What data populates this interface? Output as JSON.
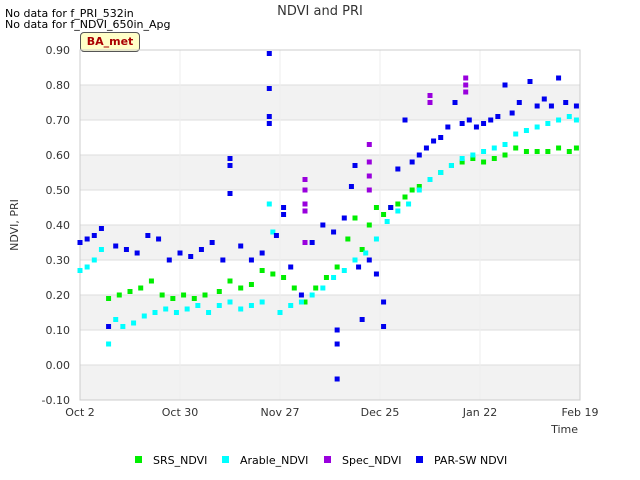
{
  "notes": [
    "No data for f_PRI_532in",
    "No data for f_NDVI_650in_Apg"
  ],
  "badge": "BA_met",
  "chart_data": {
    "type": "scatter",
    "title": "NDVI and PRI",
    "xlabel": "Time",
    "ylabel": "NDVI, PRI",
    "xlim": [
      "2022-10-02",
      "2023-02-19"
    ],
    "ylim": [
      -0.1,
      0.9
    ],
    "yticks": [
      -0.1,
      0.0,
      0.1,
      0.2,
      0.3,
      0.4,
      0.5,
      0.6,
      0.7,
      0.8,
      0.9
    ],
    "ytick_labels": [
      "-0.10",
      "0.00",
      "0.10",
      "0.20",
      "0.30",
      "0.40",
      "0.50",
      "0.60",
      "0.70",
      "0.80",
      "0.90"
    ],
    "xticks": [
      "2022-10-02",
      "2022-10-30",
      "2022-11-27",
      "2022-12-25",
      "2023-01-22",
      "2023-02-19"
    ],
    "xtick_labels": [
      "Oct 2",
      "Oct 30",
      "Nov 27",
      "Dec 25",
      "Jan 22",
      "Feb 19"
    ],
    "grid": "horizontal alternating bands",
    "legend_position": "bottom",
    "series": [
      {
        "name": "SRS_NDVI",
        "color": "#00ee00",
        "points": [
          [
            "2022-10-10",
            0.19
          ],
          [
            "2022-10-13",
            0.2
          ],
          [
            "2022-10-16",
            0.21
          ],
          [
            "2022-10-19",
            0.22
          ],
          [
            "2022-10-22",
            0.24
          ],
          [
            "2022-10-25",
            0.2
          ],
          [
            "2022-10-28",
            0.19
          ],
          [
            "2022-10-31",
            0.2
          ],
          [
            "2022-11-03",
            0.19
          ],
          [
            "2022-11-06",
            0.2
          ],
          [
            "2022-11-10",
            0.21
          ],
          [
            "2022-11-13",
            0.24
          ],
          [
            "2022-11-16",
            0.22
          ],
          [
            "2022-11-19",
            0.23
          ],
          [
            "2022-11-22",
            0.27
          ],
          [
            "2022-11-25",
            0.26
          ],
          [
            "2022-11-28",
            0.25
          ],
          [
            "2022-12-01",
            0.22
          ],
          [
            "2022-12-04",
            0.18
          ],
          [
            "2022-12-07",
            0.22
          ],
          [
            "2022-12-10",
            0.25
          ],
          [
            "2022-12-13",
            0.28
          ],
          [
            "2022-12-16",
            0.36
          ],
          [
            "2022-12-18",
            0.42
          ],
          [
            "2022-12-20",
            0.33
          ],
          [
            "2022-12-22",
            0.4
          ],
          [
            "2022-12-24",
            0.45
          ],
          [
            "2022-12-26",
            0.43
          ],
          [
            "2022-12-28",
            0.45
          ],
          [
            "2022-12-30",
            0.46
          ],
          [
            "2023-01-01",
            0.48
          ],
          [
            "2023-01-03",
            0.5
          ],
          [
            "2023-01-05",
            0.51
          ],
          [
            "2023-01-08",
            0.53
          ],
          [
            "2023-01-11",
            0.55
          ],
          [
            "2023-01-14",
            0.57
          ],
          [
            "2023-01-17",
            0.58
          ],
          [
            "2023-01-20",
            0.59
          ],
          [
            "2023-01-23",
            0.58
          ],
          [
            "2023-01-26",
            0.59
          ],
          [
            "2023-01-29",
            0.6
          ],
          [
            "2023-02-01",
            0.62
          ],
          [
            "2023-02-04",
            0.61
          ],
          [
            "2023-02-07",
            0.61
          ],
          [
            "2023-02-10",
            0.61
          ],
          [
            "2023-02-13",
            0.62
          ],
          [
            "2023-02-16",
            0.61
          ],
          [
            "2023-02-18",
            0.62
          ]
        ]
      },
      {
        "name": "Arable_NDVI",
        "color": "#00ffff",
        "points": [
          [
            "2022-10-02",
            0.27
          ],
          [
            "2022-10-04",
            0.28
          ],
          [
            "2022-10-06",
            0.3
          ],
          [
            "2022-10-08",
            0.33
          ],
          [
            "2022-10-10",
            0.06
          ],
          [
            "2022-10-12",
            0.13
          ],
          [
            "2022-10-14",
            0.11
          ],
          [
            "2022-10-17",
            0.12
          ],
          [
            "2022-10-20",
            0.14
          ],
          [
            "2022-10-23",
            0.15
          ],
          [
            "2022-10-26",
            0.16
          ],
          [
            "2022-10-29",
            0.15
          ],
          [
            "2022-11-01",
            0.16
          ],
          [
            "2022-11-04",
            0.17
          ],
          [
            "2022-11-07",
            0.15
          ],
          [
            "2022-11-10",
            0.17
          ],
          [
            "2022-11-13",
            0.18
          ],
          [
            "2022-11-16",
            0.16
          ],
          [
            "2022-11-19",
            0.17
          ],
          [
            "2022-11-22",
            0.18
          ],
          [
            "2022-11-24",
            0.46
          ],
          [
            "2022-11-25",
            0.38
          ],
          [
            "2022-11-27",
            0.15
          ],
          [
            "2022-11-30",
            0.17
          ],
          [
            "2022-12-03",
            0.18
          ],
          [
            "2022-12-06",
            0.2
          ],
          [
            "2022-12-09",
            0.22
          ],
          [
            "2022-12-12",
            0.25
          ],
          [
            "2022-12-15",
            0.27
          ],
          [
            "2022-12-18",
            0.3
          ],
          [
            "2022-12-21",
            0.32
          ],
          [
            "2022-12-24",
            0.36
          ],
          [
            "2022-12-27",
            0.41
          ],
          [
            "2022-12-30",
            0.44
          ],
          [
            "2023-01-02",
            0.46
          ],
          [
            "2023-01-05",
            0.5
          ],
          [
            "2023-01-08",
            0.53
          ],
          [
            "2023-01-11",
            0.55
          ],
          [
            "2023-01-14",
            0.57
          ],
          [
            "2023-01-17",
            0.59
          ],
          [
            "2023-01-20",
            0.6
          ],
          [
            "2023-01-23",
            0.61
          ],
          [
            "2023-01-26",
            0.62
          ],
          [
            "2023-01-29",
            0.63
          ],
          [
            "2023-02-01",
            0.66
          ],
          [
            "2023-02-04",
            0.67
          ],
          [
            "2023-02-07",
            0.68
          ],
          [
            "2023-02-10",
            0.69
          ],
          [
            "2023-02-13",
            0.7
          ],
          [
            "2023-02-16",
            0.71
          ],
          [
            "2023-02-18",
            0.7
          ]
        ]
      },
      {
        "name": "Spec_NDVI",
        "color": "#9900dd",
        "points": [
          [
            "2022-12-04",
            0.53
          ],
          [
            "2022-12-04",
            0.5
          ],
          [
            "2022-12-04",
            0.46
          ],
          [
            "2022-12-04",
            0.44
          ],
          [
            "2022-12-04",
            0.35
          ],
          [
            "2022-12-22",
            0.63
          ],
          [
            "2022-12-22",
            0.58
          ],
          [
            "2022-12-22",
            0.54
          ],
          [
            "2022-12-22",
            0.5
          ],
          [
            "2023-01-08",
            0.77
          ],
          [
            "2023-01-08",
            0.75
          ],
          [
            "2023-01-18",
            0.82
          ],
          [
            "2023-01-18",
            0.8
          ],
          [
            "2023-01-18",
            0.78
          ]
        ]
      },
      {
        "name": "PAR-SW NDVI",
        "color": "#0000ee",
        "points": [
          [
            "2022-10-02",
            0.35
          ],
          [
            "2022-10-04",
            0.36
          ],
          [
            "2022-10-06",
            0.37
          ],
          [
            "2022-10-08",
            0.39
          ],
          [
            "2022-10-10",
            0.11
          ],
          [
            "2022-10-12",
            0.34
          ],
          [
            "2022-10-15",
            0.33
          ],
          [
            "2022-10-18",
            0.32
          ],
          [
            "2022-10-21",
            0.37
          ],
          [
            "2022-10-24",
            0.36
          ],
          [
            "2022-10-27",
            0.3
          ],
          [
            "2022-10-30",
            0.32
          ],
          [
            "2022-11-02",
            0.31
          ],
          [
            "2022-11-05",
            0.33
          ],
          [
            "2022-11-08",
            0.35
          ],
          [
            "2022-11-11",
            0.3
          ],
          [
            "2022-11-13",
            0.59
          ],
          [
            "2022-11-13",
            0.57
          ],
          [
            "2022-11-13",
            0.49
          ],
          [
            "2022-11-16",
            0.34
          ],
          [
            "2022-11-19",
            0.3
          ],
          [
            "2022-11-22",
            0.32
          ],
          [
            "2022-11-24",
            0.89
          ],
          [
            "2022-11-24",
            0.79
          ],
          [
            "2022-11-24",
            0.71
          ],
          [
            "2022-11-24",
            0.69
          ],
          [
            "2022-11-26",
            0.37
          ],
          [
            "2022-11-28",
            0.45
          ],
          [
            "2022-11-28",
            0.43
          ],
          [
            "2022-11-30",
            0.28
          ],
          [
            "2022-12-03",
            0.2
          ],
          [
            "2022-12-06",
            0.35
          ],
          [
            "2022-12-09",
            0.4
          ],
          [
            "2022-12-12",
            0.38
          ],
          [
            "2022-12-13",
            0.1
          ],
          [
            "2022-12-13",
            0.06
          ],
          [
            "2022-12-13",
            -0.04
          ],
          [
            "2022-12-15",
            0.42
          ],
          [
            "2022-12-17",
            0.51
          ],
          [
            "2022-12-18",
            0.57
          ],
          [
            "2022-12-19",
            0.28
          ],
          [
            "2022-12-20",
            0.13
          ],
          [
            "2022-12-22",
            0.3
          ],
          [
            "2022-12-24",
            0.26
          ],
          [
            "2022-12-26",
            0.18
          ],
          [
            "2022-12-26",
            0.11
          ],
          [
            "2022-12-28",
            0.45
          ],
          [
            "2022-12-30",
            0.56
          ],
          [
            "2023-01-01",
            0.7
          ],
          [
            "2023-01-03",
            0.58
          ],
          [
            "2023-01-05",
            0.6
          ],
          [
            "2023-01-07",
            0.62
          ],
          [
            "2023-01-09",
            0.64
          ],
          [
            "2023-01-11",
            0.65
          ],
          [
            "2023-01-13",
            0.68
          ],
          [
            "2023-01-15",
            0.75
          ],
          [
            "2023-01-17",
            0.69
          ],
          [
            "2023-01-19",
            0.7
          ],
          [
            "2023-01-21",
            0.68
          ],
          [
            "2023-01-23",
            0.69
          ],
          [
            "2023-01-25",
            0.7
          ],
          [
            "2023-01-27",
            0.71
          ],
          [
            "2023-01-29",
            0.8
          ],
          [
            "2023-01-31",
            0.72
          ],
          [
            "2023-02-02",
            0.75
          ],
          [
            "2023-02-05",
            0.81
          ],
          [
            "2023-02-07",
            0.74
          ],
          [
            "2023-02-09",
            0.76
          ],
          [
            "2023-02-11",
            0.74
          ],
          [
            "2023-02-13",
            0.82
          ],
          [
            "2023-02-15",
            0.75
          ],
          [
            "2023-02-18",
            0.74
          ]
        ]
      }
    ]
  }
}
